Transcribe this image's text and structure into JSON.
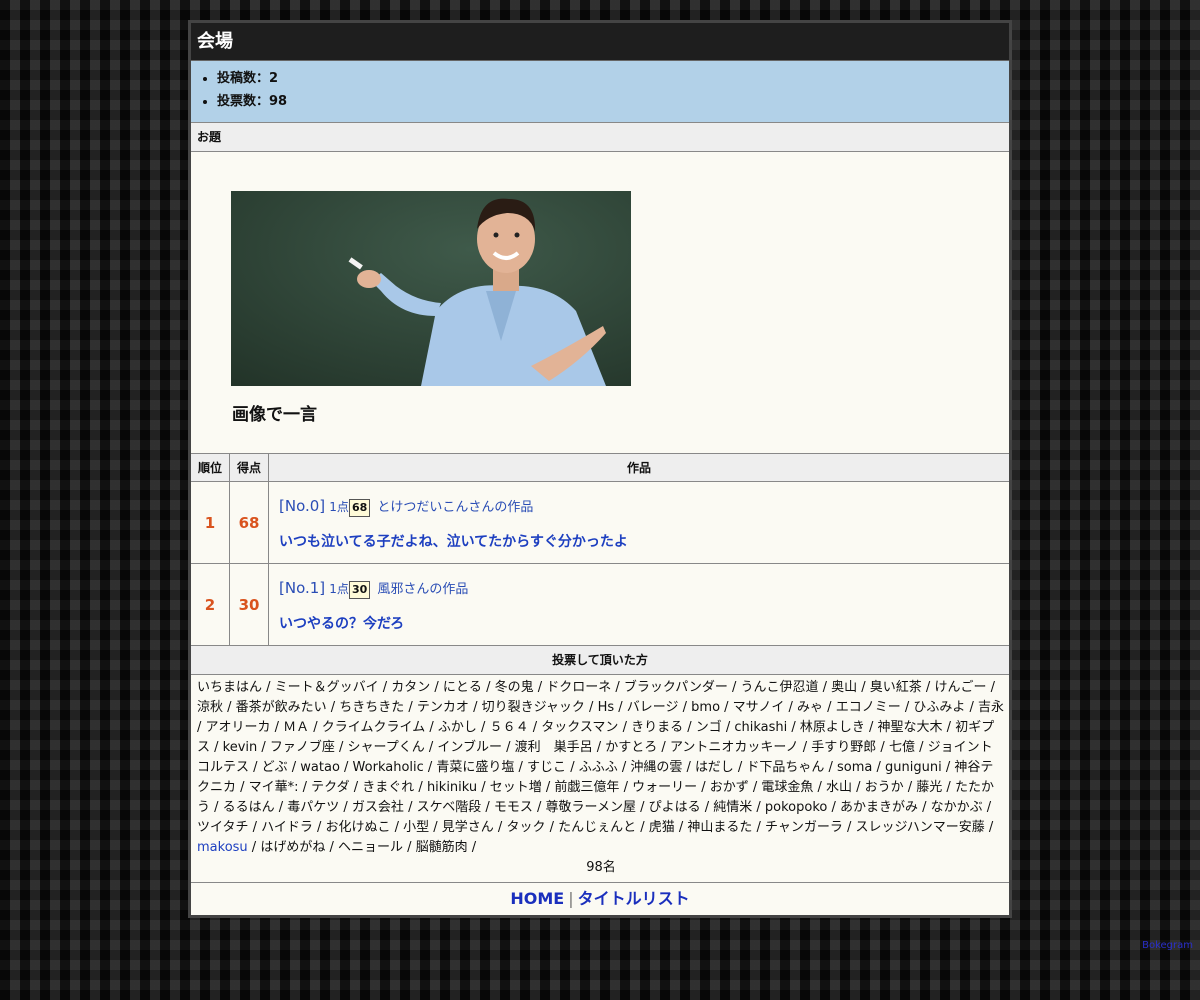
{
  "header": {
    "title": "会場"
  },
  "stats": [
    {
      "label": "投稿数：2"
    },
    {
      "label": "投票数：98"
    }
  ],
  "odai": {
    "section_label": "お題",
    "caption": "画像で一言"
  },
  "ranking": {
    "headers": {
      "rank": "順位",
      "score": "得点",
      "work": "作品"
    },
    "rows": [
      {
        "rank": "1",
        "score": "68",
        "no": "[No.0]",
        "points": "1点",
        "badge": "68",
        "author": "とけつだいこんさんの作品",
        "title": "いつも泣いてる子だよね、泣いてたからすぐ分かったよ"
      },
      {
        "rank": "2",
        "score": "30",
        "no": "[No.1]",
        "points": "1点",
        "badge": "30",
        "author": "風邪さんの作品",
        "title": "いつやるの？今だろ"
      }
    ]
  },
  "voters": {
    "heading": "投票して頂いた方",
    "list_before": "いちまはん / ミート＆グッバイ / カタン / にとる / 冬の鬼 / ドクローネ / ブラックパンダー / うんこ伊忍道 / 奥山 / 臭い紅茶 / けんごー / 涼秋 / 番茶が飲みたい / ちきちきた / テンカオ / 切り裂きジャック / Hs / バレージ / bmo / マサノイ / みゃ / エコノミー / ひふみよ / 吉永 / アオリーカ / ＭＡ / クライムクライム / ふかし / ５６４ / タックスマン / きりまる / ンゴ / chikashi / 林原よしき / 神聖な大木 / 初ギプス / kevin / ファノブ座 / シャープくん / インブルー / 渡利　巣手呂 / かすとろ / アントニオカッキーノ / 手すり野郎 / 七億 / ジョイントコルテス / どぶ / watao / Workaholic / 青菜に盛り塩 / すじこ / ふふふ / 沖縄の雲 / はだし / ド下品ちゃん / soma / guniguni / 神谷テクニカ / マイ華*: / テクダ / きまぐれ / hikiniku / セット増 / 前戯三億年 / ウォーリー / おかず / 電球金魚 / 水山 / おうか / 藤光 / たたかう / るるはん / 毒パケツ / ガス会社 / スケベ階段 / モモス / 尊敬ラーメン屋 / ぴよはる / 純情米 / pokopoko / あかまきがみ / なかかぶ / ツイタチ / ハイドラ / お化けぬこ / 小型 / 見学さん / タック / たんじぇんと / 虎猫 / 神山まるた / チャンガーラ / スレッジハンマー安藤 / ",
    "highlight": "makosu",
    "list_after": " / はげめがね / ヘニョール / 脳髄筋肉 /",
    "count": "98名"
  },
  "footer": {
    "home": "HOME",
    "separator": "|",
    "title_list": "タイトルリスト"
  },
  "credit": "Bokegram"
}
